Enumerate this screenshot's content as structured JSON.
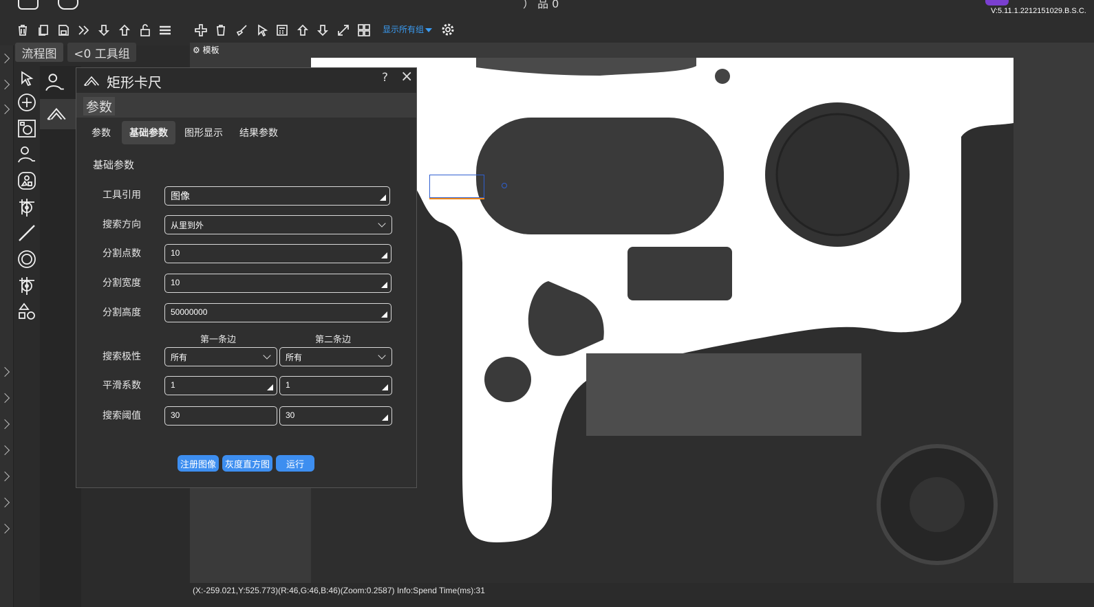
{
  "app": {
    "version": "V:5.11.1.2212151029.B.S.C.",
    "top_text": "）  品  0"
  },
  "toolbar": {
    "group_select": "显示所有组"
  },
  "nav": {
    "flow_tab": "流程图",
    "group_tab": "<0  工具组"
  },
  "canvas": {
    "template_label": "模板"
  },
  "status": {
    "text": "(X:-259.021,Y:525.773)(R:46,G:46,B:46)(Zoom:0.2587)  Info:Spend Time(ms):31"
  },
  "dialog": {
    "title": "矩形卡尺",
    "help": "?",
    "close": "×",
    "subtitle": "参数",
    "tabs": [
      "参数",
      "基础参数",
      "图形显示",
      "结果参数"
    ],
    "active_tab": 1,
    "section": "基础参数",
    "fields": {
      "tool_ref": {
        "label": "工具引用",
        "value": "图像"
      },
      "search_dir": {
        "label": "搜索方向",
        "value": "从里到外"
      },
      "split_points": {
        "label": "分割点数",
        "value": "10"
      },
      "split_width": {
        "label": "分割宽度",
        "value": "10"
      },
      "split_height": {
        "label": "分割高度",
        "value": "50000000"
      }
    },
    "col1": "第一条边",
    "col2": "第二条边",
    "polarity": {
      "label": "搜索极性",
      "edge1": "所有",
      "edge2": "所有"
    },
    "smooth": {
      "label": "平滑系数",
      "edge1": "1",
      "edge2": "1"
    },
    "threshold": {
      "label": "搜索阈值",
      "edge1": "30",
      "edge2": "30"
    },
    "buttons": {
      "register": "注册图像",
      "histogram": "灰度直方图",
      "run": "运行"
    }
  }
}
